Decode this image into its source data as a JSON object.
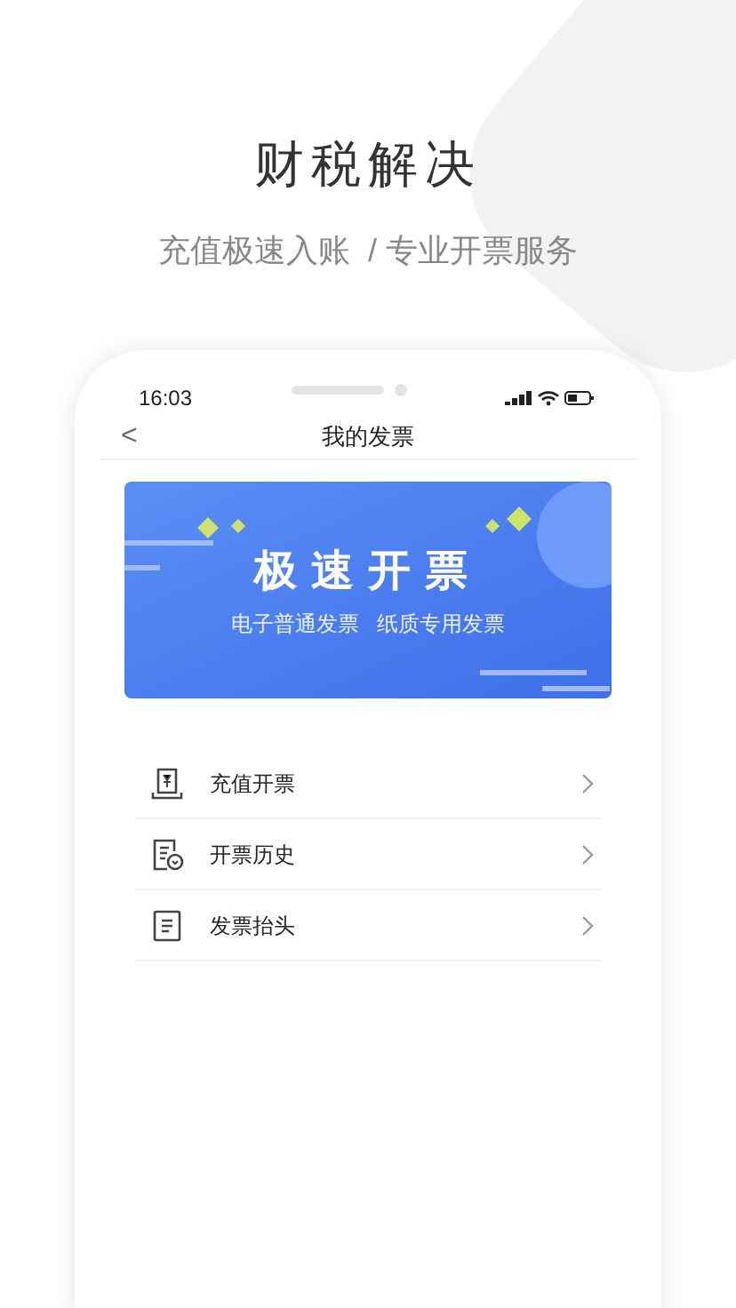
{
  "headline": "财税解决",
  "subtitle": "充值极速入账  / 专业开票服务",
  "status_bar": {
    "time": "16:03"
  },
  "nav": {
    "back": "<",
    "title": "我的发票"
  },
  "banner": {
    "title": "极速开票",
    "subtitle": "电子普通发票   纸质专用发票"
  },
  "menu": [
    {
      "kind": "recharge",
      "label": "充值开票"
    },
    {
      "kind": "history",
      "label": "开票历史"
    },
    {
      "kind": "document",
      "label": "发票抬头"
    }
  ]
}
